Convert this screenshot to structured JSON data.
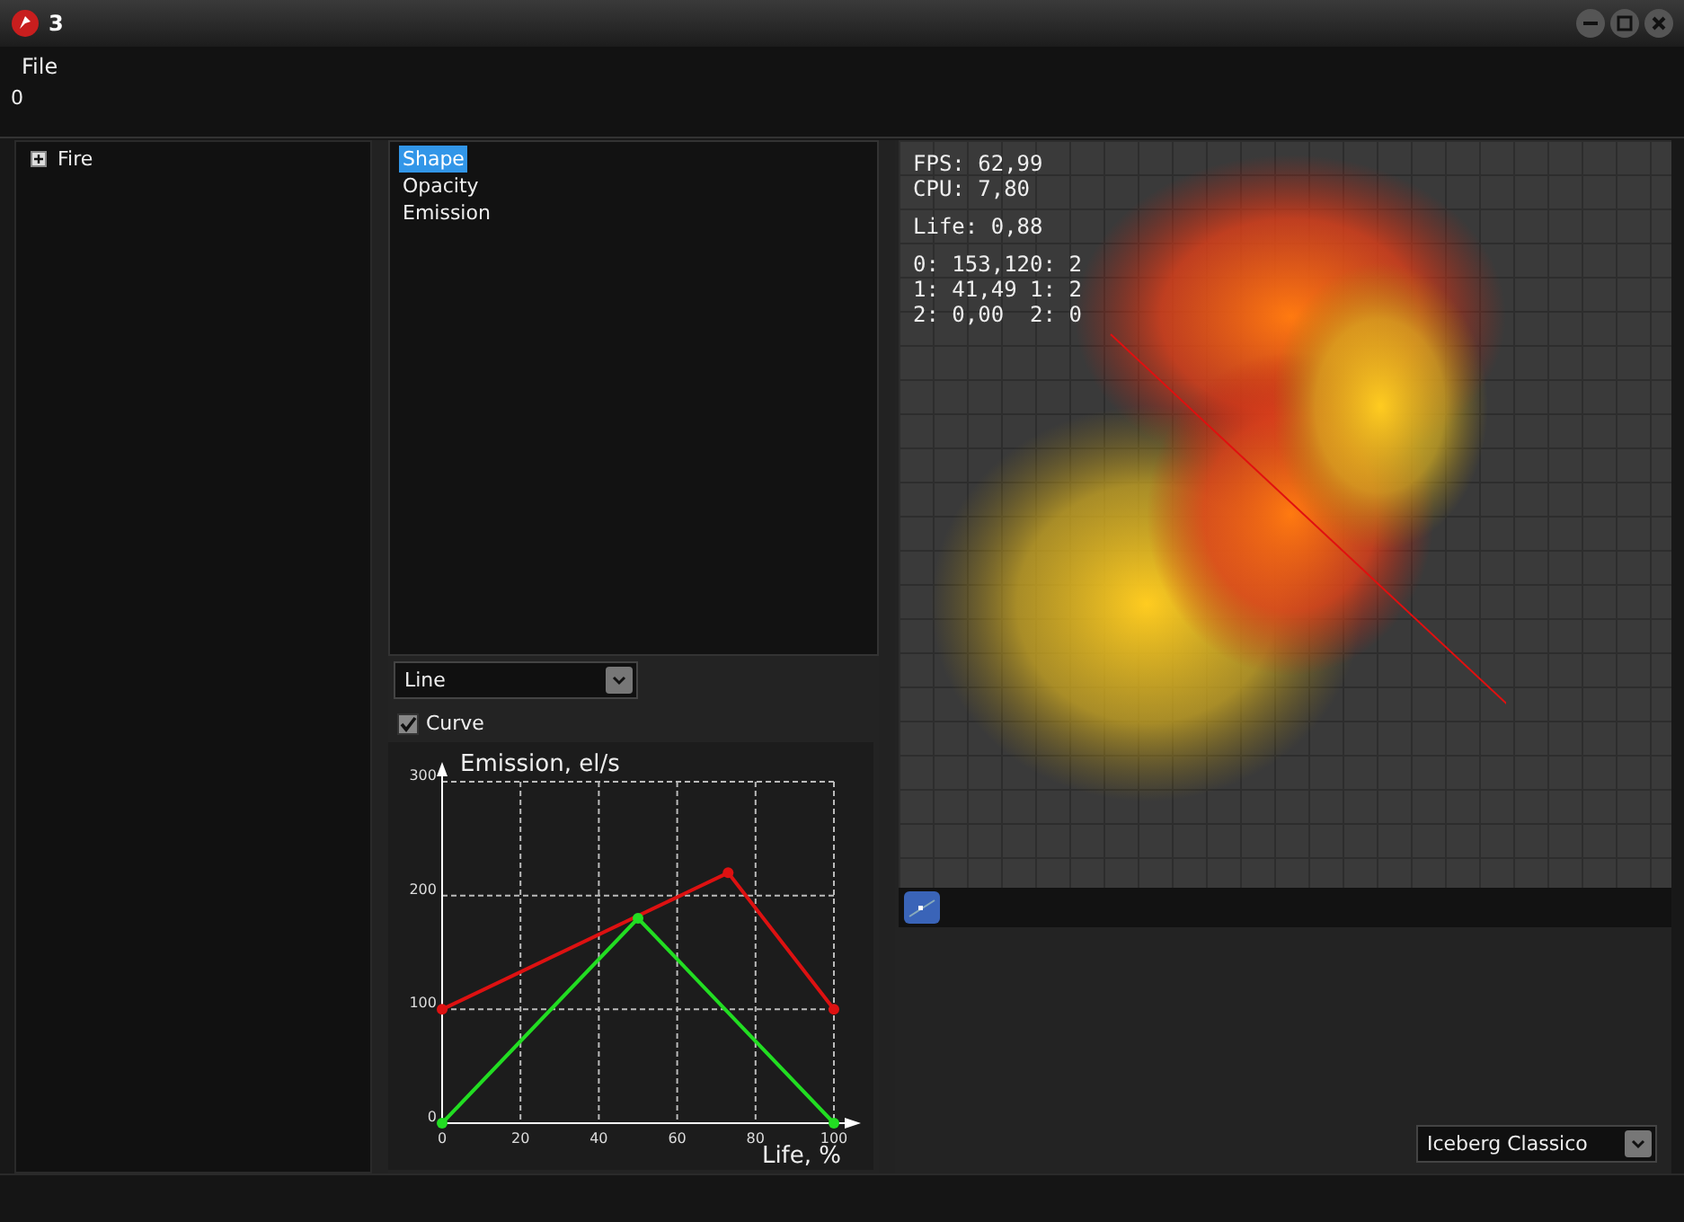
{
  "window": {
    "title": "3"
  },
  "menu": [
    "File"
  ],
  "info_line": "0",
  "tree": [
    {
      "label": "Fire",
      "expanded": false
    }
  ],
  "properties": [
    {
      "label": "Shape",
      "selected": true
    },
    {
      "label": "Opacity",
      "selected": false
    },
    {
      "label": "Emission",
      "selected": false
    }
  ],
  "mode_select": {
    "value": "Line"
  },
  "curve_checkbox": {
    "label": "Curve",
    "checked": true
  },
  "emission_chart": {
    "chart_data": {
      "type": "line",
      "grid": true,
      "xlabel": "Life, %",
      "ylabel": "Emission, el/s",
      "xlim": [
        0,
        100
      ],
      "ylim": [
        0,
        300
      ],
      "xticks": [
        0,
        20,
        40,
        60,
        80,
        100
      ],
      "yticks": [
        0,
        100,
        200,
        300
      ],
      "x": [
        0,
        50,
        73,
        100
      ],
      "series": [
        {
          "color": "#dd1111",
          "marker": true,
          "values": [
            100,
            null,
            220,
            100
          ]
        },
        {
          "color": "#22dd22",
          "marker": true,
          "values": [
            0,
            180,
            null,
            0
          ]
        }
      ]
    }
  },
  "viewport_stats": [
    "FPS: 62,99",
    "CPU: 7,80",
    "Life: 0,88",
    "0: 153,120: 2",
    "1: 41,49 1: 2",
    "2: 0,00  2: 0"
  ],
  "theme_select": {
    "value": "Iceberg Classico"
  }
}
